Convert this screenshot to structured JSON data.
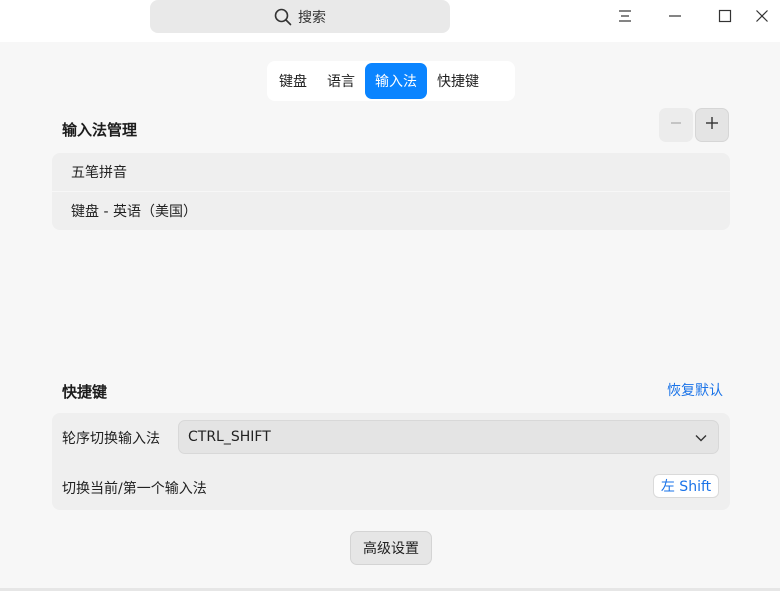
{
  "titlebar": {
    "search_label": "搜索",
    "icons": {
      "search": "search-icon",
      "menu": "menu-icon",
      "minimize": "minimize-icon",
      "maximize": "maximize-icon",
      "close": "close-icon"
    }
  },
  "tabs": [
    {
      "label": "键盘",
      "active": false
    },
    {
      "label": "语言",
      "active": false
    },
    {
      "label": "输入法",
      "active": true
    },
    {
      "label": "快捷键",
      "active": false
    }
  ],
  "input_methods": {
    "title": "输入法管理",
    "remove_button": "−",
    "add_button": "+",
    "items": [
      "五笔拼音",
      "键盘 - 英语（美国）"
    ]
  },
  "shortcuts": {
    "title": "快捷键",
    "restore_defaults": "恢复默认",
    "cycle_label": "轮序切换输入法",
    "cycle_value": "CTRL_SHIFT",
    "switch_label": "切换当前/第一个输入法",
    "switch_key": "左 Shift"
  },
  "advanced_button": "高级设置",
  "colors": {
    "accent": "#0a84ff",
    "link": "#1a73e8",
    "background": "#f7f7f7"
  }
}
